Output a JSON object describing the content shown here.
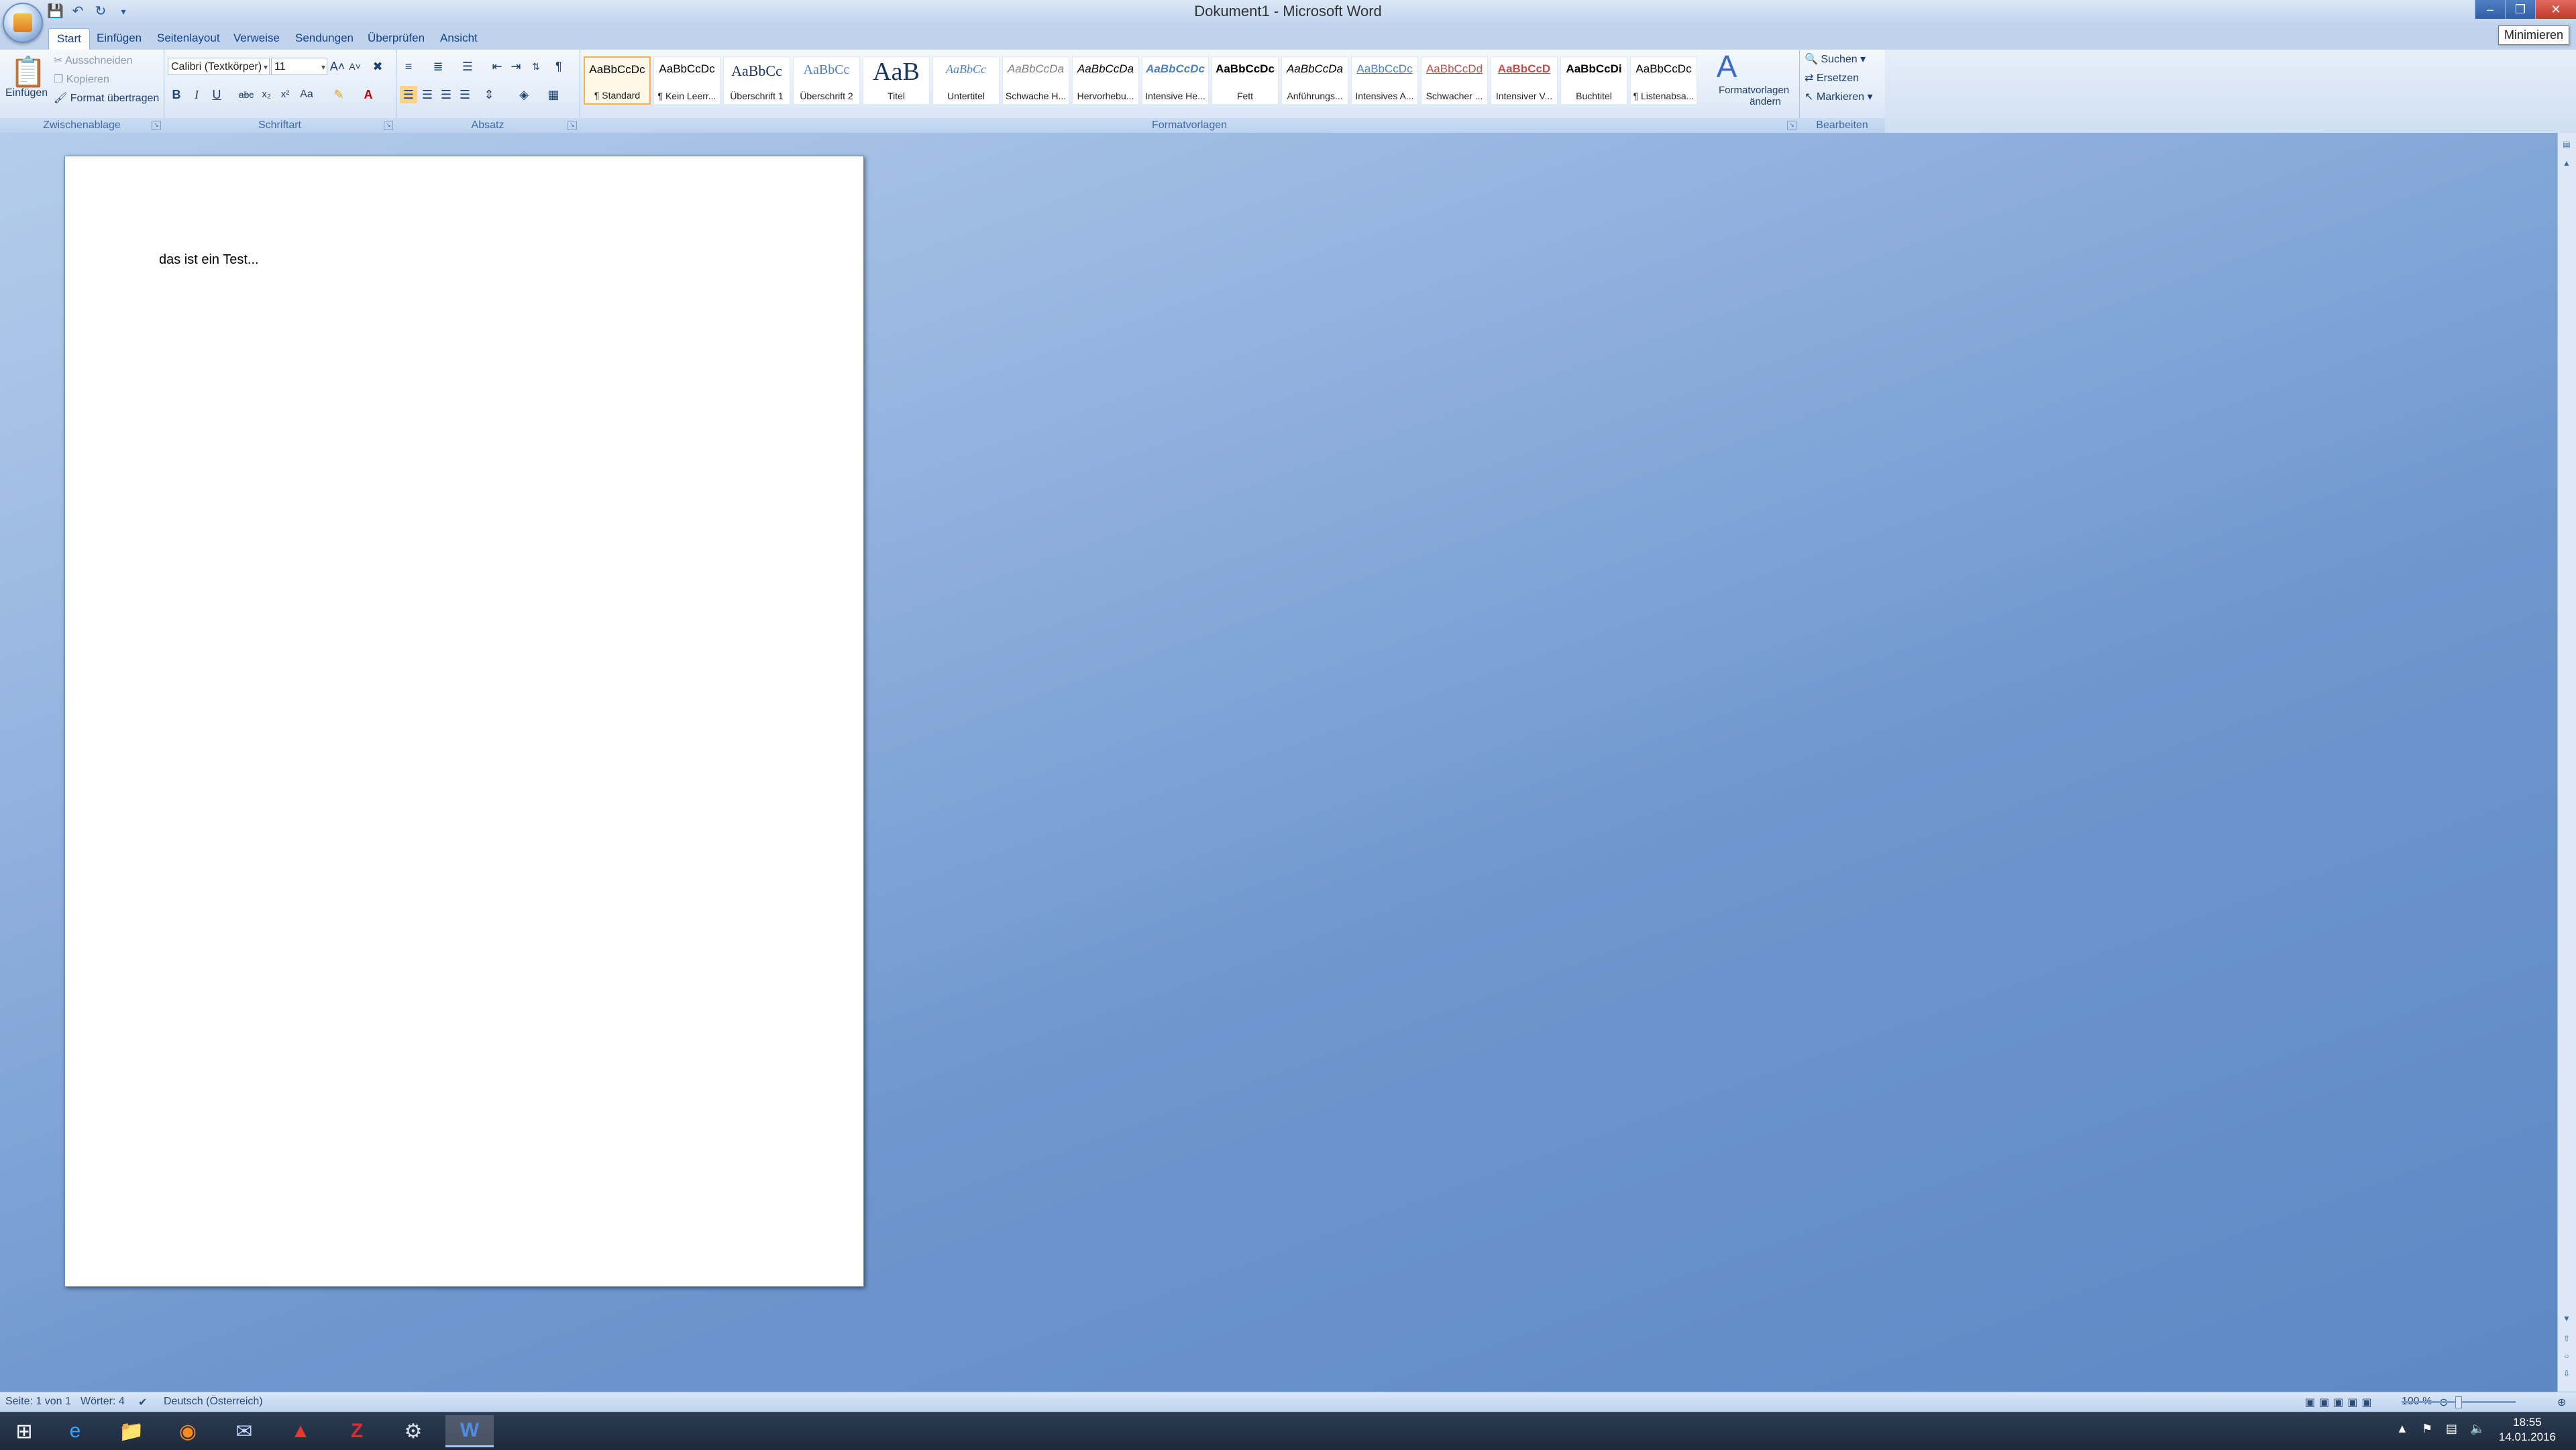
{
  "window": {
    "title": "Dokument1 - Microsoft Word",
    "tooltip": "Minimieren",
    "controls": {
      "minimize": "–",
      "restore": "❐",
      "close": "✕"
    }
  },
  "qat": {
    "save": "💾",
    "undo": "↶",
    "redo": "↻",
    "more": "▾"
  },
  "tabs": [
    "Start",
    "Einfügen",
    "Seitenlayout",
    "Verweise",
    "Sendungen",
    "Überprüfen",
    "Ansicht"
  ],
  "ribbon": {
    "clipboard": {
      "label": "Zwischenablage",
      "paste": "Einfügen",
      "cut": "Ausschneiden",
      "copy": "Kopieren",
      "format_painter": "Format übertragen"
    },
    "font": {
      "label": "Schriftart",
      "font_name": "Calibri (Textkörper)",
      "font_size": "11",
      "bold": "B",
      "italic": "I",
      "underline": "U",
      "strike": "abc",
      "sub": "x₂",
      "sup": "x²",
      "case": "Aa",
      "grow": "A˄",
      "shrink": "A˅"
    },
    "paragraph": {
      "label": "Absatz",
      "pilcrow": "¶"
    },
    "styles": {
      "label": "Formatvorlagen",
      "items": [
        {
          "sample": "AaBbCcDc",
          "name": "¶ Standard"
        },
        {
          "sample": "AaBbCcDc",
          "name": "¶ Kein Leerr..."
        },
        {
          "sample": "AaBbCc",
          "name": "Überschrift 1"
        },
        {
          "sample": "AaBbCc",
          "name": "Überschrift 2"
        },
        {
          "sample": "AaB",
          "name": "Titel"
        },
        {
          "sample": "AaBbCc",
          "name": "Untertitel"
        },
        {
          "sample": "AaBbCcDa",
          "name": "Schwache H..."
        },
        {
          "sample": "AaBbCcDa",
          "name": "Hervorhebu..."
        },
        {
          "sample": "AaBbCcDc",
          "name": "Intensive He..."
        },
        {
          "sample": "AaBbCcDc",
          "name": "Fett"
        },
        {
          "sample": "AaBbCcDa",
          "name": "Anführungs..."
        },
        {
          "sample": "AaBbCcDc",
          "name": "Intensives A..."
        },
        {
          "sample": "AaBbCcDd",
          "name": "Schwacher ..."
        },
        {
          "sample": "AaBbCcD",
          "name": "Intensiver V..."
        },
        {
          "sample": "AaBbCcDi",
          "name": "Buchtitel"
        },
        {
          "sample": "AaBbCcDc",
          "name": "¶ Listenabsa..."
        }
      ],
      "change_styles_line1": "Formatvorlagen",
      "change_styles_line2": "ändern"
    },
    "editing": {
      "label": "Bearbeiten",
      "find": "Suchen",
      "replace": "Ersetzen",
      "select": "Markieren"
    }
  },
  "document": {
    "text": "das ist ein Test..."
  },
  "statusbar": {
    "page": "Seite: 1 von 1",
    "words": "Wörter: 4",
    "language": "Deutsch (Österreich)",
    "zoom": "100 %"
  },
  "taskbar": {
    "time": "18:55",
    "date": "14.01.2016"
  },
  "colors": {
    "ribbon_text": "#15428b",
    "canvas": "#6f97ce",
    "taskbar": "#1d2a3d"
  }
}
